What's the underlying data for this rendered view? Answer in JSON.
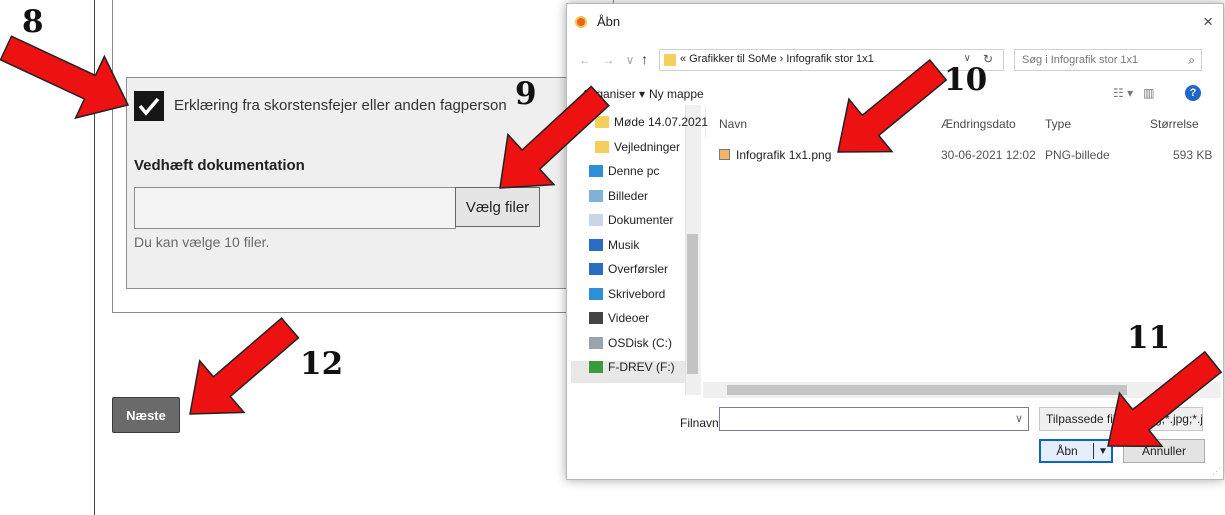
{
  "steps": [
    "8",
    "9",
    "10",
    "11",
    "12"
  ],
  "form": {
    "checkbox_label": "Erklæring fra skorstensfejer eller anden fagperson",
    "attach_title": "Vedhæft dokumentation",
    "choose_files": "Vælg filer",
    "hint": "Du kan vælge 10 filer.",
    "next": "Næste"
  },
  "dialog": {
    "title": "Åbn",
    "close": "×",
    "address_path": "« Grafikker til SoMe › Infografik stor 1x1",
    "search_placeholder": "Søg i Infografik stor 1x1",
    "toolbar": {
      "organise": "Organiser ▾",
      "new_folder": "Ny mappe"
    },
    "nav_items": [
      {
        "label": "Møde 14.07.2021",
        "icon": "folder-icon"
      },
      {
        "label": "Vejledninger",
        "icon": "folder-icon"
      },
      {
        "label": "Denne pc",
        "icon": "computer-icon"
      },
      {
        "label": "Billeder",
        "icon": "pictures-icon"
      },
      {
        "label": "Dokumenter",
        "icon": "documents-icon"
      },
      {
        "label": "Musik",
        "icon": "music-icon"
      },
      {
        "label": "Overførsler",
        "icon": "download-icon"
      },
      {
        "label": "Skrivebord",
        "icon": "desktop-icon"
      },
      {
        "label": "Videoer",
        "icon": "video-icon"
      },
      {
        "label": "OSDisk (C:)",
        "icon": "disk-icon"
      },
      {
        "label": "F-DREV (F:)",
        "icon": "network-drive-icon"
      }
    ],
    "columns": [
      "Navn",
      "Ændringsdato",
      "Type",
      "Størrelse"
    ],
    "files": [
      {
        "name": "Infografik 1x1.png",
        "date": "30-06-2021 12:02",
        "type": "PNG-billede",
        "size": "593 KB"
      }
    ],
    "filename_label": "Filnavn:",
    "filename_value": "",
    "filetype": "Tilpassede filer (*.png;*.jpg;*.jpeg;*.gif;*.pdf)",
    "open": "Åbn",
    "cancel": "Annuller"
  },
  "colors": {
    "arrow": "#ee1111",
    "accent": "#0c64c8"
  }
}
